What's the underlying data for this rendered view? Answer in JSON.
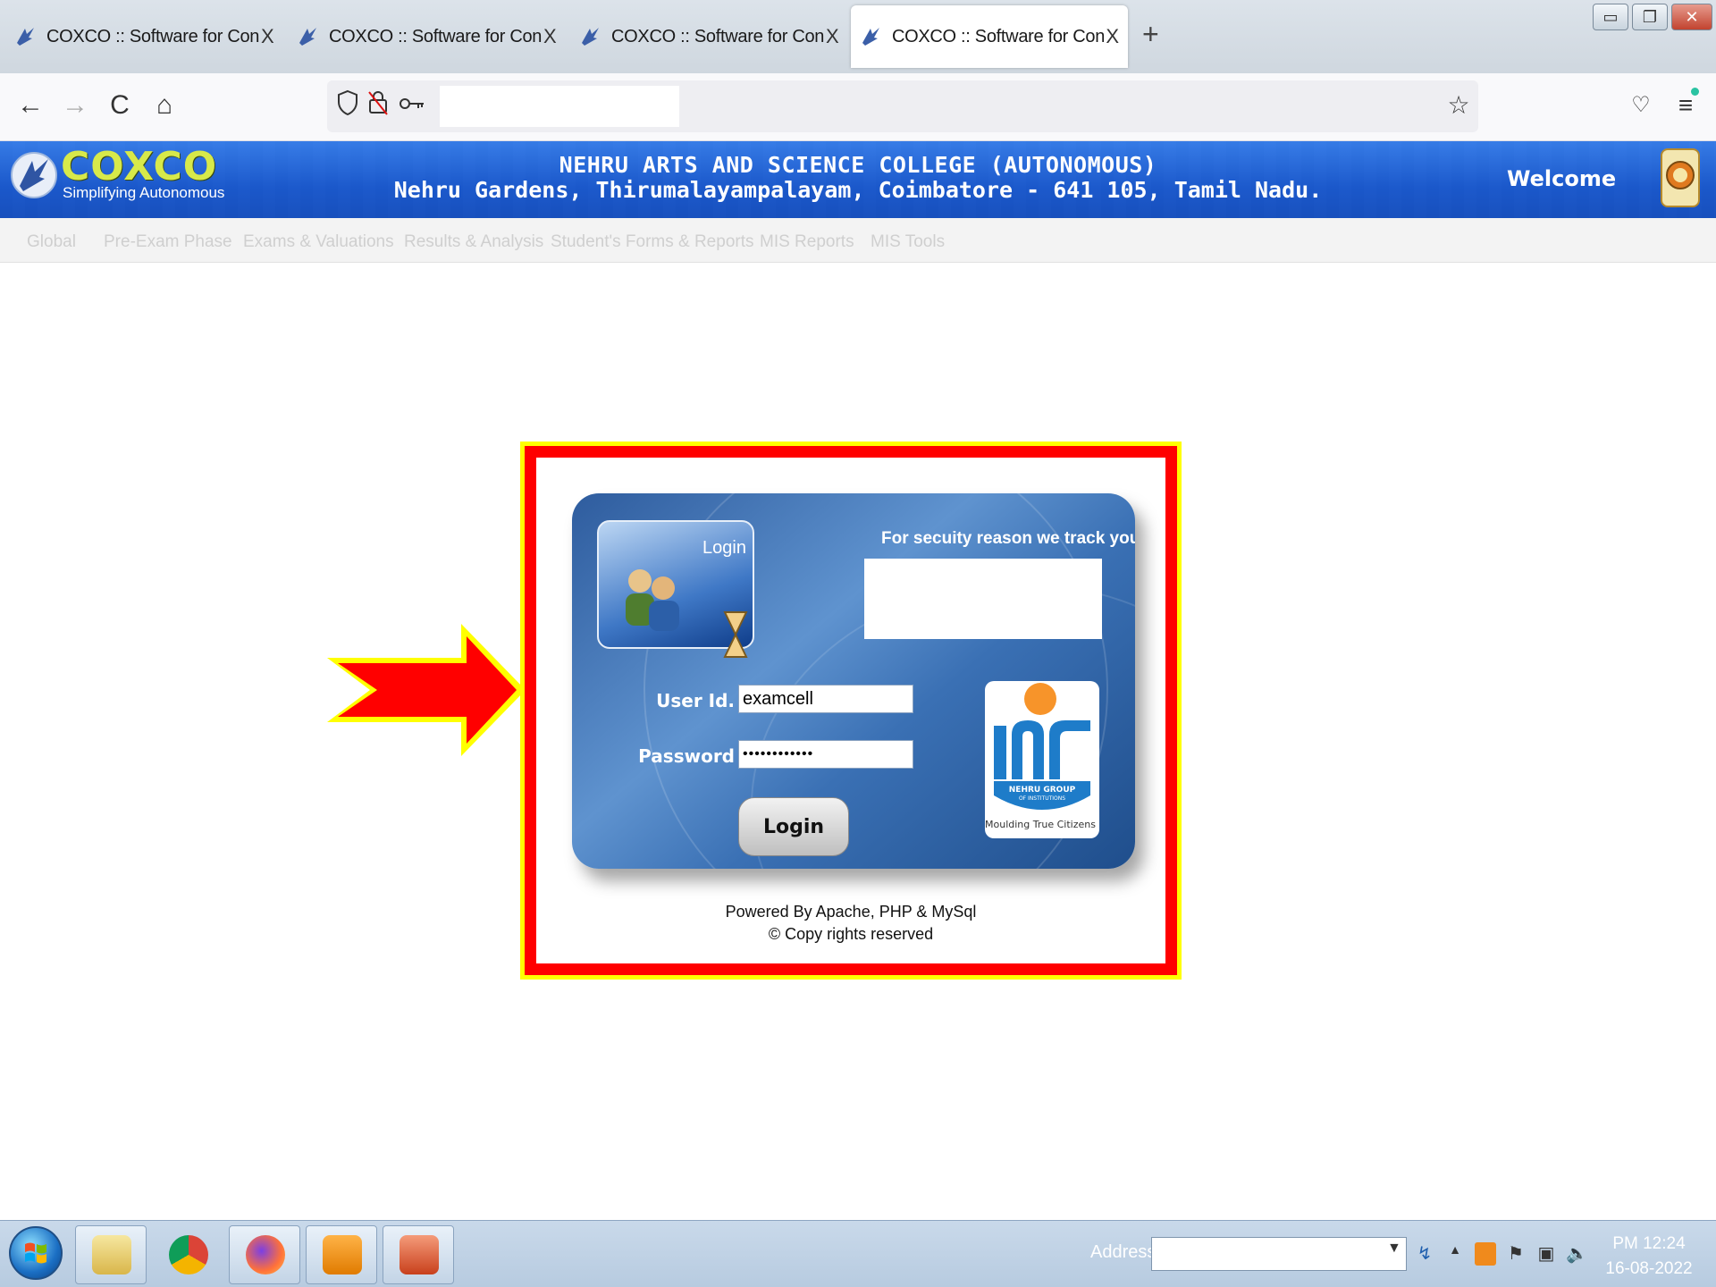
{
  "browser": {
    "tabs": [
      {
        "title": "COXCO :: Software for Controlle",
        "close": "X"
      },
      {
        "title": "COXCO :: Software for Controlle",
        "close": "X"
      },
      {
        "title": "COXCO :: Software for Controlle",
        "close": "X"
      },
      {
        "title": "COXCO :: Software for Controlle",
        "close": "X"
      }
    ],
    "active_tab_index": 3,
    "new_tab": "+",
    "nav": {
      "back": "←",
      "forward": "→",
      "reload": "C",
      "home": "⌂",
      "bookmark": "☆",
      "pocket": "♡",
      "menu": "≡"
    },
    "url": ""
  },
  "site": {
    "logo": {
      "name": "COXCO",
      "tagline": "Simplifying Autonomous"
    },
    "college_name": "NEHRU ARTS AND SCIENCE COLLEGE (AUTONOMOUS)",
    "college_address": "Nehru Gardens, Thirumalayampalayam, Coimbatore - 641 105, Tamil Nadu.",
    "welcome": "Welcome",
    "menu": [
      "Global",
      "Pre-Exam Phase",
      "Exams & Valuations",
      "Results & Analysis",
      "Student's Forms & Reports",
      "MIS Reports",
      "MIS Tools"
    ]
  },
  "login": {
    "image_label": "Login",
    "security_message": "For secuity reason we track your",
    "user_label": "User Id.",
    "user_value": "examcell",
    "password_label": "Password",
    "password_value": "••••••••••••",
    "button": "Login",
    "logo_text_1": "NEHRU GROUP",
    "logo_text_2": "OF INSTITUTIONS",
    "logo_tagline": "Moulding True Citizens"
  },
  "footer": {
    "powered": "Powered By Apache, PHP & MySql",
    "copyright": "© Copy rights reserved"
  },
  "annotation": {
    "highlight_color": "#ff0000",
    "arrow_color": "#ff0000",
    "outline_color": "#ffff00"
  },
  "taskbar": {
    "address_label": "Address",
    "time": "PM 12:24",
    "date": "16-08-2022",
    "apps": [
      "file-explorer-icon",
      "chrome-icon",
      "firefox-icon",
      "sync-app-icon",
      "presentation-app-icon"
    ]
  },
  "colors": {
    "header_blue": "#1f63d8",
    "logo_yellow": "#d7e94a",
    "card_blue": "#3a70b4"
  }
}
